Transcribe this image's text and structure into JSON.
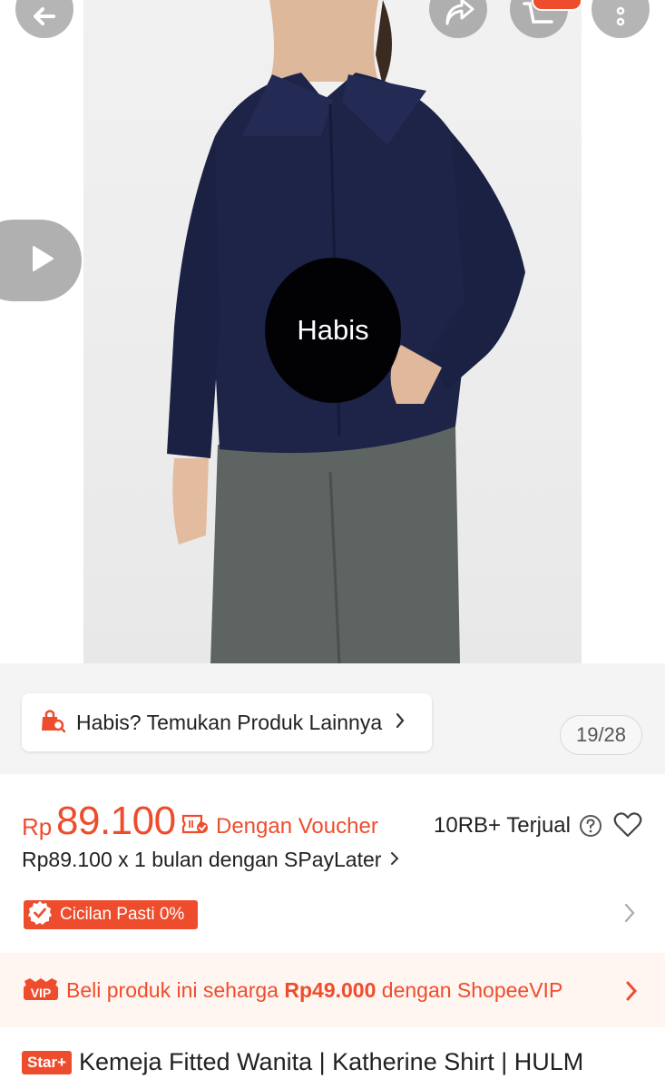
{
  "image": {
    "sold_out_label": "Habis",
    "counter": "19/28"
  },
  "header": {
    "back_icon": "arrow-left-icon",
    "share_icon": "share-icon",
    "cart_icon": "cart-icon",
    "more_icon": "more-vertical-icon",
    "video_icon": "play-icon"
  },
  "sold_out_banner": {
    "label": "Habis? Temukan Produk Lainnya",
    "icon": "shopping-bag-search-icon"
  },
  "price": {
    "currency": "Rp",
    "amount": "89.100",
    "voucher_label": "Dengan Voucher",
    "voucher_icon": "voucher-check-icon",
    "sold_count": "10RB+ Terjual"
  },
  "spaylater": {
    "label": "Rp89.100 x 1 bulan dengan SPayLater"
  },
  "installment": {
    "label": "Cicilan Pasti 0%"
  },
  "vip": {
    "badge": "VIP",
    "text_before": "Beli produk ini seharga ",
    "price": "Rp49.000",
    "text_after": " dengan ShopeeVIP"
  },
  "product": {
    "badge": "Star+",
    "title": "Kemeja Fitted Wanita | Katherine Shirt | HULM"
  },
  "colors": {
    "accent": "#ee4d2d",
    "vip_bg": "#fff5f1",
    "section_bg": "#f4f4f4"
  }
}
